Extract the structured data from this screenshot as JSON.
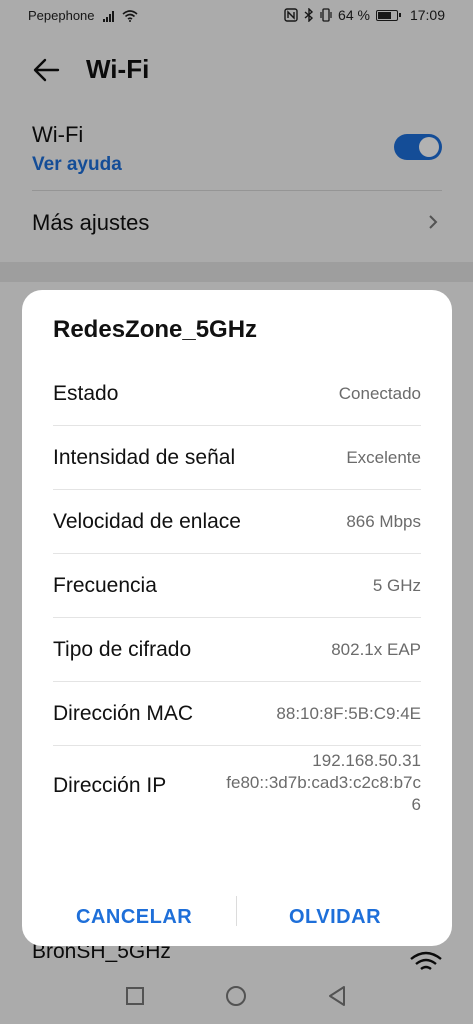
{
  "status_bar": {
    "carrier": "Pepephone",
    "battery": "64 %",
    "time": "17:09"
  },
  "app_bar": {
    "title": "Wi-Fi"
  },
  "settings": {
    "wifi_label": "Wi-Fi",
    "help_link": "Ver ayuda",
    "toggle_on": true,
    "more_settings": "Más ajustes"
  },
  "background_network": {
    "name": "BronSH_5GHz"
  },
  "dialog": {
    "title": "RedesZone_5GHz",
    "rows": [
      {
        "label": "Estado",
        "value": "Conectado"
      },
      {
        "label": "Intensidad de señal",
        "value": "Excelente"
      },
      {
        "label": "Velocidad de enlace",
        "value": "866 Mbps"
      },
      {
        "label": "Frecuencia",
        "value": "5 GHz"
      },
      {
        "label": "Tipo de cifrado",
        "value": "802.1x EAP"
      },
      {
        "label": "Dirección MAC",
        "value": "88:10:8F:5B:C9:4E"
      },
      {
        "label": "Dirección IP",
        "value_lines": [
          "192.168.50.31",
          "fe80::3d7b:cad3:c2c8:b7c",
          "6"
        ]
      }
    ],
    "cancel_label": "CANCELAR",
    "forget_label": "OLVIDAR"
  },
  "colors": {
    "accent": "#1e6fd9"
  }
}
